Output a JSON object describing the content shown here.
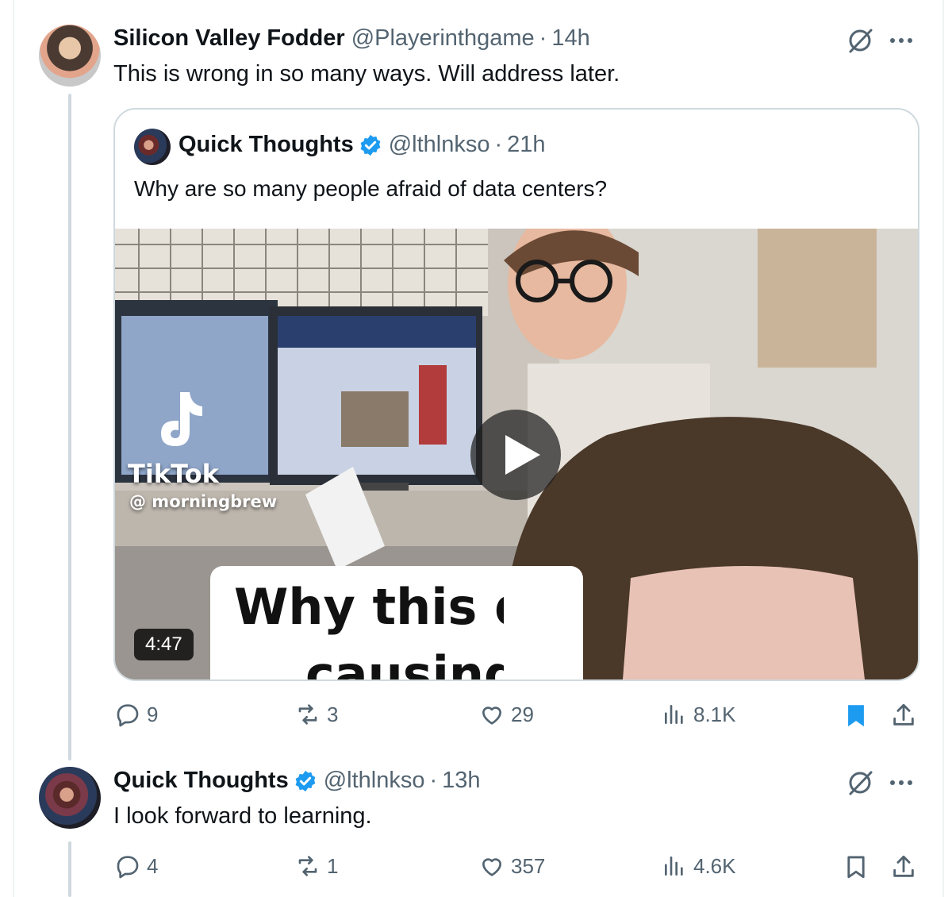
{
  "colors": {
    "text": "#0f1419",
    "secondary": "#536471",
    "blue": "#1d9bf0",
    "border": "#cfd9de"
  },
  "tweet1": {
    "name": "Silicon Valley Fodder",
    "handle": "@Playerinthgame",
    "dot": "·",
    "time": "14h",
    "text": "This is wrong in so many ways. Will address later.",
    "quote": {
      "name": "Quick Thoughts",
      "handle": "@lthlnkso",
      "dot": "·",
      "time": "21h",
      "text": "Why are so many people afraid of data centers?",
      "video": {
        "duration": "4:47",
        "watermark_brand": "TikTok",
        "watermark_handle": "@ morningbrew",
        "caption_line1": "Why this da",
        "caption_line2": "causing"
      }
    },
    "stats": {
      "replies": "9",
      "reposts": "3",
      "likes": "29",
      "views": "8.1K"
    }
  },
  "tweet2": {
    "name": "Quick Thoughts",
    "handle": "@lthlnkso",
    "dot": "·",
    "time": "13h",
    "text": "I look forward to learning.",
    "stats": {
      "replies": "4",
      "reposts": "1",
      "likes": "357",
      "views": "4.6K"
    }
  },
  "icons": [
    "grok-icon",
    "more-icon",
    "verified-icon",
    "play-icon",
    "reply-icon",
    "repost-icon",
    "like-icon",
    "views-icon",
    "bookmark-icon",
    "share-icon"
  ]
}
